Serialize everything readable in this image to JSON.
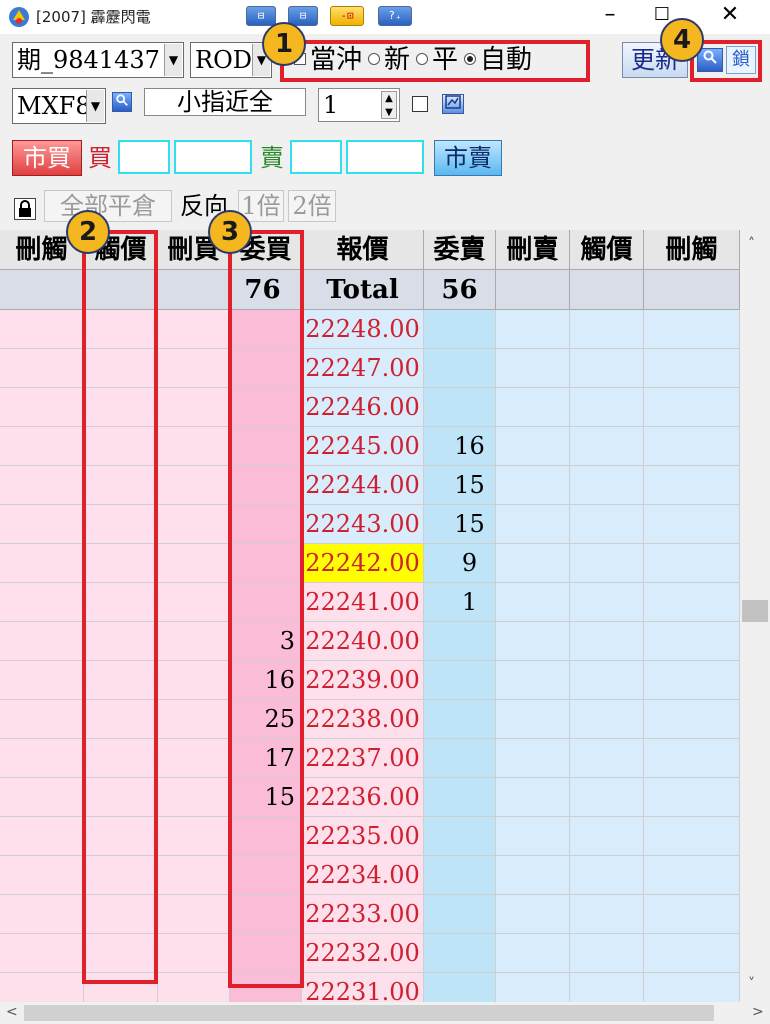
{
  "window": {
    "title": "[2007] 霹靂閃電",
    "toolbar_buttons": [
      "⊟",
      "⊟",
      "-⊡",
      "?₊"
    ],
    "controls": {
      "minimize": "–",
      "maximize": "☐",
      "close": "✕"
    }
  },
  "order_bar": {
    "account": "期_9841437",
    "order_type": "ROD",
    "daytrade_label": "當沖",
    "position_options": [
      {
        "label": "新",
        "checked": false
      },
      {
        "label": "平",
        "checked": false
      },
      {
        "label": "自動",
        "checked": true
      }
    ],
    "refresh_label": "更新",
    "lock_label": "鎖"
  },
  "product_bar": {
    "symbol": "MXF8",
    "symbol_name": "小指近全",
    "quantity": "1"
  },
  "quick_bar": {
    "market_buy_label": "市買",
    "buy_label": "買",
    "sell_label": "賣",
    "market_sell_label": "市賣"
  },
  "action_bar": {
    "close_all_label": "全部平倉",
    "reverse_label": "反向",
    "x1_label": "1倍",
    "x2_label": "2倍"
  },
  "grid": {
    "headers": [
      "刪觸",
      "觸價",
      "刪買",
      "委買",
      "報價",
      "委賣",
      "刪賣",
      "觸價",
      "刪觸"
    ],
    "totals": {
      "buy": "76",
      "label": "Total",
      "sell": "56"
    },
    "rows": [
      {
        "price": "22248.00",
        "buy": "",
        "sell": "",
        "highlight": false
      },
      {
        "price": "22247.00",
        "buy": "",
        "sell": "",
        "highlight": false
      },
      {
        "price": "22246.00",
        "buy": "",
        "sell": "",
        "highlight": false
      },
      {
        "price": "22245.00",
        "buy": "",
        "sell": "16",
        "highlight": false
      },
      {
        "price": "22244.00",
        "buy": "",
        "sell": "15",
        "highlight": false
      },
      {
        "price": "22243.00",
        "buy": "",
        "sell": "15",
        "highlight": false
      },
      {
        "price": "22242.00",
        "buy": "",
        "sell": "9",
        "highlight": true
      },
      {
        "price": "22241.00",
        "buy": "",
        "sell": "1",
        "highlight": false
      },
      {
        "price": "22240.00",
        "buy": "3",
        "sell": "",
        "highlight": false
      },
      {
        "price": "22239.00",
        "buy": "16",
        "sell": "",
        "highlight": false
      },
      {
        "price": "22238.00",
        "buy": "25",
        "sell": "",
        "highlight": false
      },
      {
        "price": "22237.00",
        "buy": "17",
        "sell": "",
        "highlight": false
      },
      {
        "price": "22236.00",
        "buy": "15",
        "sell": "",
        "highlight": false
      },
      {
        "price": "22235.00",
        "buy": "",
        "sell": "",
        "highlight": false
      },
      {
        "price": "22234.00",
        "buy": "",
        "sell": "",
        "highlight": false
      },
      {
        "price": "22233.00",
        "buy": "",
        "sell": "",
        "highlight": false
      },
      {
        "price": "22232.00",
        "buy": "",
        "sell": "",
        "highlight": false
      },
      {
        "price": "22231.00",
        "buy": "",
        "sell": "",
        "highlight": false
      }
    ]
  },
  "annotations": [
    "1",
    "2",
    "3",
    "4"
  ],
  "colors": {
    "buy_side": "#fde0ec",
    "buy_order_column": "#fbbcd8",
    "price_column_buy": "#fde0ec",
    "price_column_sell": "#d8ecfb",
    "sell_order_column": "#bfe3f7",
    "sell_side": "#d9ecfb",
    "last_price_highlight": "#ffff00",
    "annotation_red": "#e0202a",
    "badge_yellow": "#f5b71f"
  }
}
